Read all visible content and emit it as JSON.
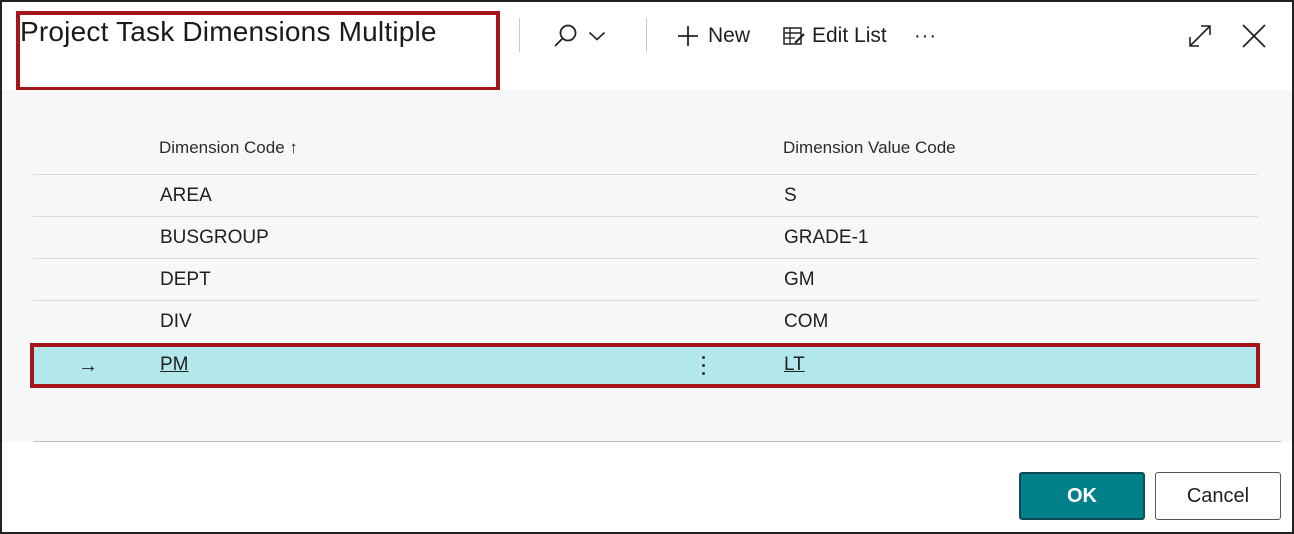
{
  "window": {
    "title": "Project Task Dimensions Multiple"
  },
  "toolbar": {
    "search_icon": "search-icon",
    "search_dropdown_icon": "chevron-down-icon",
    "new_label": "New",
    "new_icon": "plus-icon",
    "edit_list_label": "Edit List",
    "edit_list_icon": "edit-list-icon",
    "more_label": "···",
    "expand_icon": "expand-icon",
    "close_icon": "close-icon"
  },
  "table": {
    "columns": [
      {
        "label": "Dimension Code ↑"
      },
      {
        "label": "Dimension Value Code"
      }
    ],
    "rows": [
      {
        "dimension_code": "AREA",
        "dimension_value_code": "S"
      },
      {
        "dimension_code": "BUSGROUP",
        "dimension_value_code": "GRADE-1"
      },
      {
        "dimension_code": "DEPT",
        "dimension_value_code": "GM"
      },
      {
        "dimension_code": "DIV",
        "dimension_value_code": "COM"
      },
      {
        "dimension_code": "PM",
        "dimension_value_code": "LT",
        "selected": true,
        "arrow": "→"
      }
    ]
  },
  "footer": {
    "ok_label": "OK",
    "cancel_label": "Cancel"
  },
  "colors": {
    "accent": "#00818a",
    "selected_row": "#b2e8ec",
    "highlight_outline": "#a4161a"
  }
}
